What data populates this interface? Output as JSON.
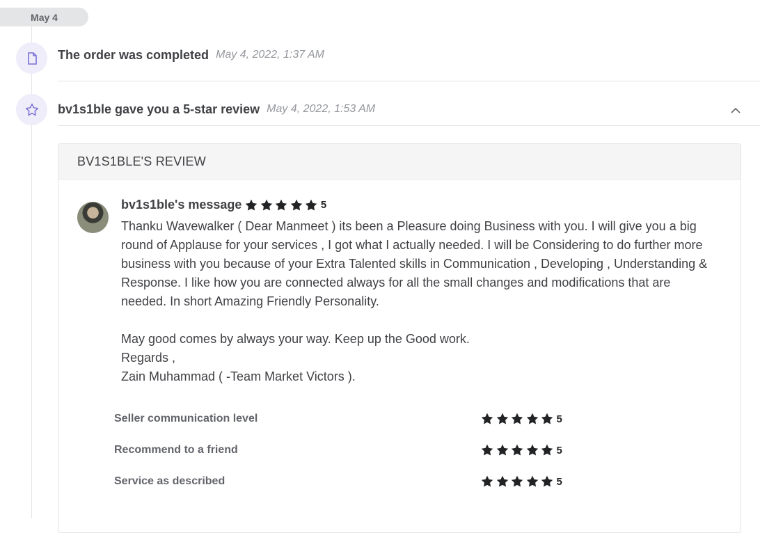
{
  "date_pill": "May 4",
  "events": [
    {
      "title": "The order was completed",
      "time": "May 4, 2022, 1:37 AM",
      "icon": "document-icon"
    },
    {
      "title": "bv1s1ble gave you a 5-star review",
      "time": "May 4, 2022, 1:53 AM",
      "icon": "star-outline-icon"
    }
  ],
  "review": {
    "header": "BV1S1BLE'S REVIEW",
    "author_label": "bv1s1ble's message",
    "rating": "5",
    "message": "Thanku Wavewalker ( Dear Manmeet ) its been a Pleasure doing Business with you. I will give you a big round of Applause for your services , I got what I actually needed. I will be Considering to do further more business with you because of your Extra Talented skills in Communication , Developing , Understanding & Response. I like how you are connected always for all the small changes and modifications that are needed. In short Amazing Friendly Personality.\n\nMay good comes by always your way. Keep up the Good work.\nRegards ,\nZain Muhammad ( -Team Market Victors ).",
    "subratings": [
      {
        "label": "Seller communication level",
        "value": "5"
      },
      {
        "label": "Recommend to a friend",
        "value": "5"
      },
      {
        "label": "Service as described",
        "value": "5"
      }
    ]
  },
  "colors": {
    "accent_bg": "#eeedf9",
    "accent_icon": "#7a6fd6",
    "star": "#222325"
  }
}
